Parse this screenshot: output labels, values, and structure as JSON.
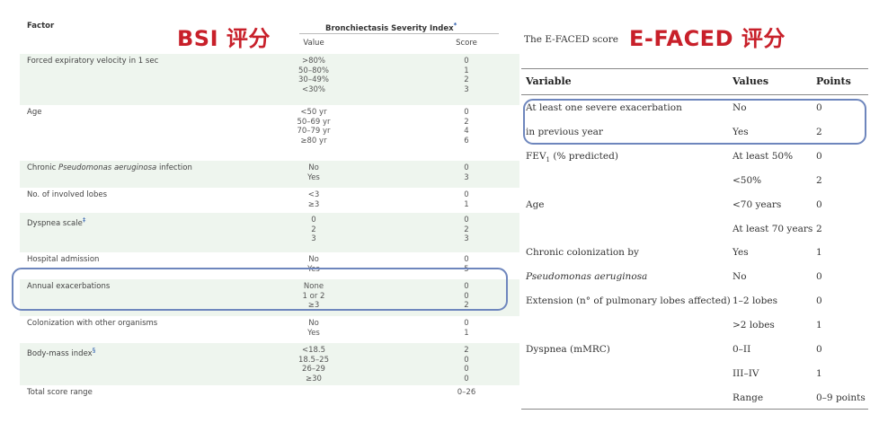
{
  "bsi": {
    "overlay_title": "BSI 评分",
    "header": {
      "factor": "Factor",
      "index": "Bronchiectasis Severity Index",
      "index_mark": "*",
      "value": "Value",
      "score": "Score"
    },
    "rows": [
      {
        "factor": "Forced expiratory velocity in 1 sec",
        "values": [
          ">80%",
          "50–80%",
          "30–49%",
          "<30%"
        ],
        "scores": [
          "0",
          "1",
          "2",
          "3"
        ]
      },
      {
        "factor": "Age",
        "values": [
          "<50 yr",
          "50–69 yr",
          "70–79 yr",
          "≥80 yr"
        ],
        "scores": [
          "0",
          "2",
          "4",
          "6"
        ]
      },
      {
        "factor_pre": "Chronic ",
        "factor_italic": "Pseudomonas aeruginosa",
        "factor_post": " infection",
        "values": [
          "No",
          "Yes"
        ],
        "scores": [
          "0",
          "3"
        ]
      },
      {
        "factor": "No. of involved lobes",
        "values": [
          "<3",
          "≥3"
        ],
        "scores": [
          "0",
          "1"
        ]
      },
      {
        "factor": "Dyspnea scale",
        "factor_mark": "‡",
        "values": [
          "0",
          "2",
          "3"
        ],
        "scores": [
          "0",
          "2",
          "3"
        ]
      },
      {
        "factor": "Hospital admission",
        "values": [
          "No",
          "Yes"
        ],
        "scores": [
          "0",
          "5"
        ]
      },
      {
        "factor": "Annual exacerbations",
        "values": [
          "None",
          "1 or 2",
          "≥3"
        ],
        "scores": [
          "0",
          "0",
          "2"
        ]
      },
      {
        "factor": "Colonization with other organisms",
        "values": [
          "No",
          "Yes"
        ],
        "scores": [
          "0",
          "1"
        ]
      },
      {
        "factor": "Body-mass index",
        "factor_mark": "§",
        "values": [
          "<18.5",
          "18.5–25",
          "26–29",
          "≥30"
        ],
        "scores": [
          "2",
          "0",
          "0",
          "0"
        ]
      },
      {
        "factor": "Total score range",
        "values": [],
        "scores": [
          "0–26"
        ]
      }
    ]
  },
  "efaced": {
    "overlay_title": "E-FACED 评分",
    "caption": "The E-FACED score",
    "header": {
      "variable": "Variable",
      "values": "Values",
      "points": "Points"
    },
    "rows": [
      {
        "variable": "At least one severe exacerbation",
        "value": "No",
        "points": "0"
      },
      {
        "variable": "in previous year",
        "value": "Yes",
        "points": "2"
      },
      {
        "variable": "FEV",
        "variable_sub": "1",
        "variable_post": " (% predicted)",
        "value": "At least 50%",
        "points": "0"
      },
      {
        "variable": "",
        "value": "<50%",
        "points": "2"
      },
      {
        "variable": "Age",
        "value": "<70 years",
        "points": "0"
      },
      {
        "variable": "",
        "value": "At least 70 years",
        "points": "2"
      },
      {
        "variable": "Chronic colonization by",
        "value": "Yes",
        "points": "1"
      },
      {
        "variable": "Pseudomonas aeruginosa",
        "italic": true,
        "value": "No",
        "points": "0"
      },
      {
        "variable": "Extension (n° of pulmonary lobes affected)",
        "value": "1–2 lobes",
        "points": "0"
      },
      {
        "variable": "",
        "value": ">2 lobes",
        "points": "1"
      },
      {
        "variable": "Dyspnea (mMRC)",
        "value": "0–II",
        "points": "0"
      },
      {
        "variable": "",
        "value": "III–IV",
        "points": "1"
      },
      {
        "variable": "",
        "value": "Range",
        "points": "0–9 points"
      }
    ]
  },
  "colors": {
    "title_red": "#c8202a",
    "highlight_blue": "#6e86bd",
    "row_shade": "#eef5ee"
  }
}
